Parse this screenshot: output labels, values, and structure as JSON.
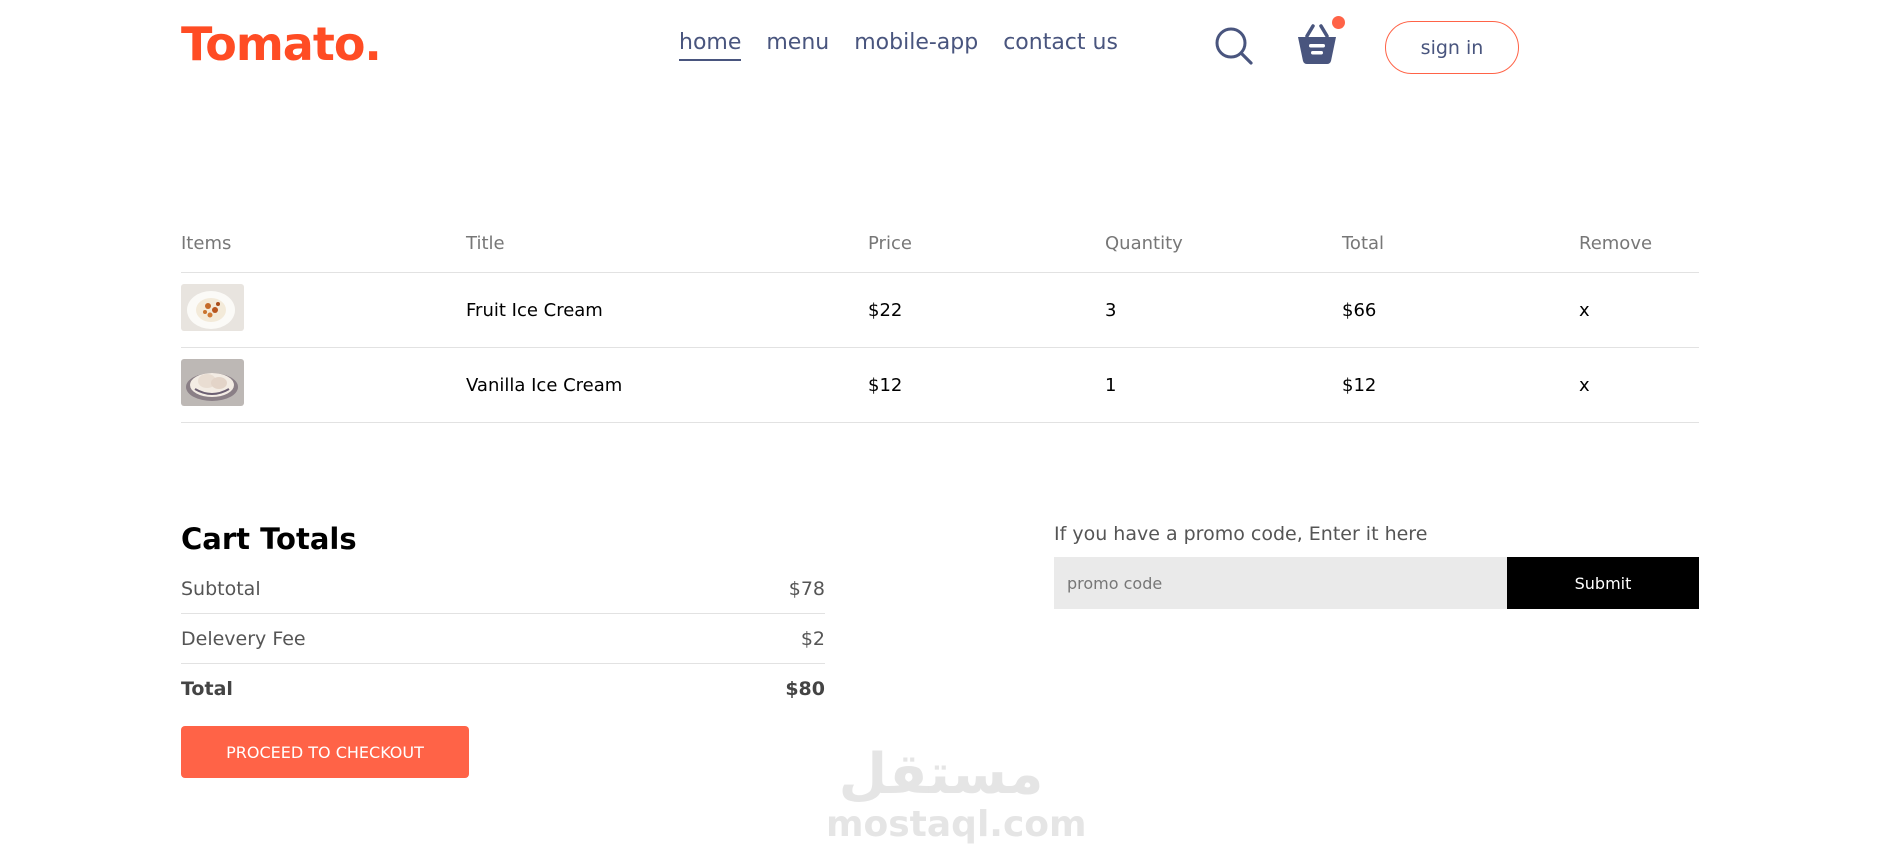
{
  "brand": {
    "logo": "Tomato.",
    "accent": "#ff6347"
  },
  "nav": {
    "items": [
      "home",
      "menu",
      "mobile-app",
      "contact us"
    ],
    "active": "home",
    "sign_in": "sign in"
  },
  "cart": {
    "headers": [
      "Items",
      "Title",
      "Price",
      "Quantity",
      "Total",
      "Remove"
    ],
    "rows": [
      {
        "title": "Fruit Ice Cream",
        "price": "$22",
        "quantity": "3",
        "total": "$66",
        "remove": "x"
      },
      {
        "title": "Vanilla Ice Cream",
        "price": "$12",
        "quantity": "1",
        "total": "$12",
        "remove": "x"
      }
    ]
  },
  "totals": {
    "heading": "Cart Totals",
    "subtotal_label": "Subtotal",
    "subtotal_value": "$78",
    "delivery_label": "Delevery Fee",
    "delivery_value": "$2",
    "total_label": "Total",
    "total_value": "$80",
    "checkout_label": "PROCEED TO CHECKOUT"
  },
  "promo": {
    "label": "If you have a promo code, Enter it here",
    "placeholder": "promo code",
    "submit_label": "Submit"
  },
  "watermark": {
    "arabic": "مستقل",
    "latin": "mostaql.com"
  }
}
